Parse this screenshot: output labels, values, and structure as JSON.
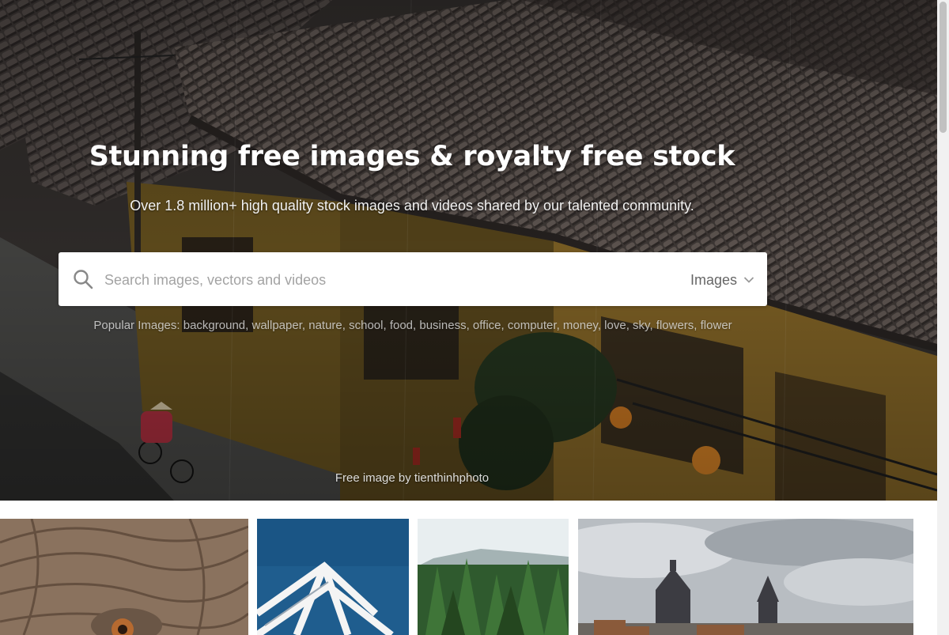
{
  "hero": {
    "title": "Stunning free images & royalty free stock",
    "subtitle": "Over 1.8 million+ high quality stock images and videos shared by our talented community.",
    "credit": "Free image by tienthinhphoto"
  },
  "search": {
    "placeholder": "Search images, vectors and videos",
    "value": "",
    "type_selected": "Images",
    "icon": "search-icon"
  },
  "popular": {
    "label": "Popular Images:",
    "terms": [
      "background",
      "wallpaper",
      "nature",
      "school",
      "food",
      "business",
      "office",
      "computer",
      "money",
      "love",
      "sky",
      "flowers",
      "flower"
    ]
  },
  "grid": {
    "images": [
      {
        "name": "elephant-eye-photo"
      },
      {
        "name": "building-blue-sky-photo"
      },
      {
        "name": "forest-photo"
      },
      {
        "name": "castle-town-photo"
      }
    ]
  },
  "colors": {
    "text_light": "#ffffff",
    "search_bg": "#ffffff",
    "placeholder": "#a3a3a3"
  }
}
